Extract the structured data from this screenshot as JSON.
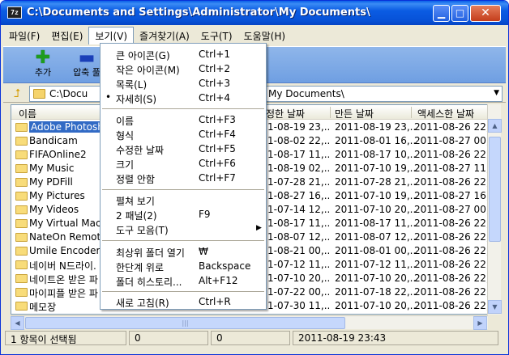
{
  "window": {
    "icon_text": "7z",
    "title": "C:\\Documents and Settings\\Administrator\\My Documents\\",
    "minimize": "▁",
    "maximize": "□",
    "close": "✕"
  },
  "menubar": [
    {
      "label": "파일(F)"
    },
    {
      "label": "편집(E)"
    },
    {
      "label": "보기(V)"
    },
    {
      "label": "즐겨찾기(A)"
    },
    {
      "label": "도구(T)"
    },
    {
      "label": "도움말(H)"
    }
  ],
  "toolbar": {
    "add_label": "추가",
    "extract_label": "압축 풀"
  },
  "address": {
    "prefix": "C:\\Docu",
    "suffix": "My Documents\\"
  },
  "columns": {
    "name": "이름",
    "modified": "정한 날짜",
    "created": "만든 날짜",
    "accessed": "액세스한 날짜"
  },
  "rows": [
    {
      "name": "Adobe Photosh",
      "modified": "1-08-19 23,..",
      "created": "2011-08-19 23,..",
      "accessed": "2011-08-26 22,.."
    },
    {
      "name": "Bandicam",
      "modified": "1-08-02 22,..",
      "created": "2011-08-01 16,..",
      "accessed": "2011-08-27 00,.."
    },
    {
      "name": "FIFAOnline2",
      "modified": "1-08-17 11,..",
      "created": "2011-08-17 10,..",
      "accessed": "2011-08-26 22,.."
    },
    {
      "name": "My Music",
      "modified": "1-08-19 02,..",
      "created": "2011-07-10 19,..",
      "accessed": "2011-08-27 11,.."
    },
    {
      "name": "My PDFill",
      "modified": "1-07-28 21,..",
      "created": "2011-07-28 21,..",
      "accessed": "2011-08-26 22,.."
    },
    {
      "name": "My Pictures",
      "modified": "1-08-27 16,..",
      "created": "2011-07-10 19,..",
      "accessed": "2011-08-27 16,.."
    },
    {
      "name": "My Videos",
      "modified": "1-07-14 12,..",
      "created": "2011-07-10 20,..",
      "accessed": "2011-08-27 00,.."
    },
    {
      "name": "My Virtual Mac",
      "modified": "1-08-17 11,..",
      "created": "2011-08-17 11,..",
      "accessed": "2011-08-26 22,.."
    },
    {
      "name": "NateOn Remote",
      "modified": "1-08-07 12,..",
      "created": "2011-08-07 12,..",
      "accessed": "2011-08-26 22,.."
    },
    {
      "name": "Umile Encoder",
      "modified": "1-08-21 00,..",
      "created": "2011-08-01 00,..",
      "accessed": "2011-08-26 22,.."
    },
    {
      "name": "네이버 N드라이.",
      "modified": "1-07-12 11,..",
      "created": "2011-07-12 11,..",
      "accessed": "2011-08-26 22,.."
    },
    {
      "name": "네이트온 받은 파",
      "modified": "1-07-10 20,..",
      "created": "2011-07-10 20,..",
      "accessed": "2011-08-26 22,.."
    },
    {
      "name": "마이피플 받은 파",
      "modified": "1-07-22 00,..",
      "created": "2011-07-18 22,..",
      "accessed": "2011-08-26 22,.."
    },
    {
      "name": "메모장",
      "modified": "1-07-30 11,..",
      "created": "2011-07-10 20,..",
      "accessed": "2011-08-26 22,.."
    }
  ],
  "view_menu": {
    "large_icons": {
      "label": "큰 아이콘(G)",
      "shortcut": "Ctrl+1"
    },
    "small_icons": {
      "label": "작은 아이콘(M)",
      "shortcut": "Ctrl+2"
    },
    "list": {
      "label": "목록(L)",
      "shortcut": "Ctrl+3"
    },
    "details": {
      "label": "자세히(S)",
      "shortcut": "Ctrl+4",
      "bullet": "•"
    },
    "sort_name": {
      "label": "이름",
      "shortcut": "Ctrl+F3"
    },
    "sort_type": {
      "label": "형식",
      "shortcut": "Ctrl+F4"
    },
    "sort_date": {
      "label": "수정한 날짜",
      "shortcut": "Ctrl+F5"
    },
    "sort_size": {
      "label": "크기",
      "shortcut": "Ctrl+F6"
    },
    "unsorted": {
      "label": "정렬 안함",
      "shortcut": "Ctrl+F7"
    },
    "flat_view": {
      "label": "펼쳐 보기",
      "shortcut": ""
    },
    "two_panels": {
      "label": "2 패널(2)",
      "shortcut": "F9"
    },
    "toolbars": {
      "label": "도구 모음(T)",
      "shortcut": ""
    },
    "open_root": {
      "label": "최상위 폴더 열기",
      "shortcut": "₩"
    },
    "up_one_level": {
      "label": "한단계 위로",
      "shortcut": "Backspace"
    },
    "folder_history": {
      "label": "폴더 히스토리...",
      "shortcut": "Alt+F12"
    },
    "refresh": {
      "label": "새로 고침(R)",
      "shortcut": "Ctrl+R"
    }
  },
  "statusbar": {
    "selection": "1 항목이 선택됨",
    "size": "0",
    "packed": "0",
    "date": "2011-08-19 23:43"
  }
}
